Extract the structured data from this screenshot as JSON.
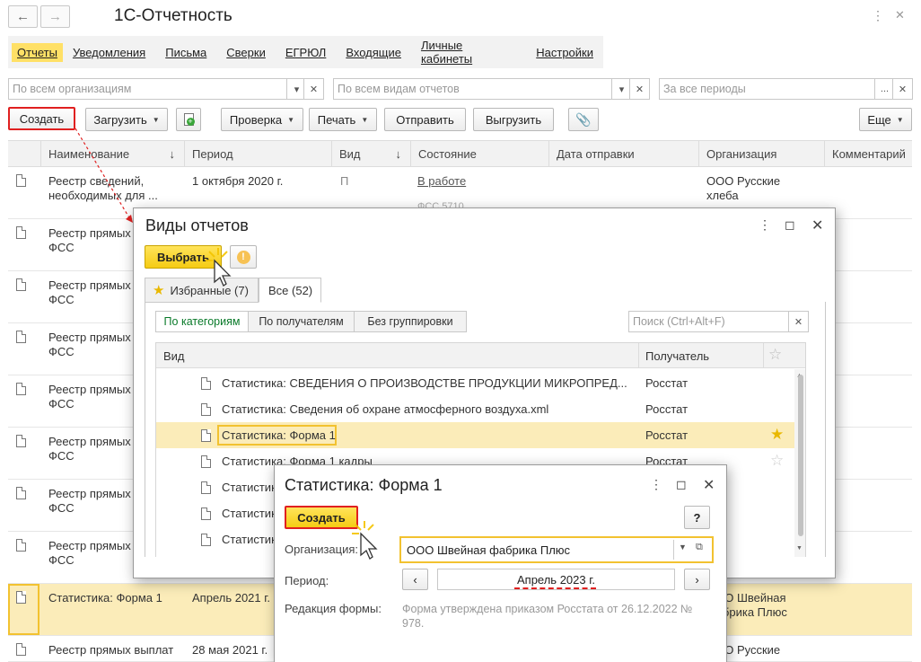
{
  "app": {
    "title": "1С-Отчетность",
    "back_icon": "arrow-left-icon",
    "forward_icon": "arrow-right-icon"
  },
  "menu": [
    "Отчеты",
    "Уведомления",
    "Письма",
    "Сверки",
    "ЕГРЮЛ",
    "Входящие",
    "Личные кабинеты",
    "Настройки"
  ],
  "filters": {
    "org_placeholder": "По всем организациям",
    "kind_placeholder": "По всем видам отчетов",
    "period_placeholder": "За все периоды"
  },
  "toolbar": {
    "create": "Создать",
    "load": "Загрузить",
    "check": "Проверка",
    "print": "Печать",
    "send": "Отправить",
    "export": "Выгрузить",
    "more": "Еще"
  },
  "table": {
    "columns": [
      "Наименование",
      "Период",
      "Вид",
      "Состояние",
      "Дата отправки",
      "Организация",
      "Комментарий"
    ],
    "rows": [
      {
        "name": "Реестр сведений, необходимых для ...",
        "period": "1 октября 2020 г.",
        "kind": "П",
        "state": "В работе",
        "state_sub": "ФСС 5710...",
        "org": "ООО Русские хлеба"
      },
      {
        "name": "Реестр прямых ФСС"
      },
      {
        "name": "Реестр прямых ФСС"
      },
      {
        "name": "Реестр прямых ФСС"
      },
      {
        "name": "Реестр прямых ФСС"
      },
      {
        "name": "Реестр прямых ФСС"
      },
      {
        "name": "Реестр прямых ФСС"
      },
      {
        "name": "Реестр прямых ФСС"
      },
      {
        "name": "Статистика: Форма 1",
        "period": "Апрель 2021 г.",
        "org": "ООО Швейная фабрика Плюс"
      },
      {
        "name": "Реестр прямых выплат",
        "period": "28 мая 2021 г.",
        "org": "ООО Русские"
      }
    ]
  },
  "kinds_window": {
    "title": "Виды отчетов",
    "select_button": "Выбрать",
    "tabs": [
      "Избранные (7)",
      "Все (52)"
    ],
    "segments": [
      "По категориям",
      "По получателям",
      "Без группировки"
    ],
    "search_placeholder": "Поиск (Ctrl+Alt+F)",
    "col_kind": "Вид",
    "col_recipient": "Получатель",
    "items": [
      {
        "name": "Статистика: СВЕДЕНИЯ О ПРОИЗВОДСТВЕ ПРОДУКЦИИ МИКРОПРЕД...",
        "recipient": "Росстат"
      },
      {
        "name": "Статистика: Сведения об охране атмосферного воздуха.xml",
        "recipient": "Росстат"
      },
      {
        "name": "Статистика: Форма 1",
        "recipient": "Росстат",
        "favorite": true
      },
      {
        "name": "Статистика: Форма 1 кадры",
        "recipient": "Росстат"
      },
      {
        "name": "Статистик"
      },
      {
        "name": "Статистик"
      },
      {
        "name": "Статистик"
      }
    ]
  },
  "form_window": {
    "title": "Статистика: Форма 1",
    "create_button": "Создать",
    "help": "?",
    "org_label": "Организация:",
    "org_value": "ООО Швейная фабрика Плюс",
    "period_label": "Период:",
    "period_value": "Апрель 2023 г.",
    "edition_label": "Редакция формы:",
    "edition_value": "Форма утверждена приказом Росстата от 26.12.2022 № 978."
  },
  "colors": {
    "accent_yellow": "#f5cc14",
    "highlight_row": "#fbecb9",
    "red_frame": "#e02020"
  }
}
